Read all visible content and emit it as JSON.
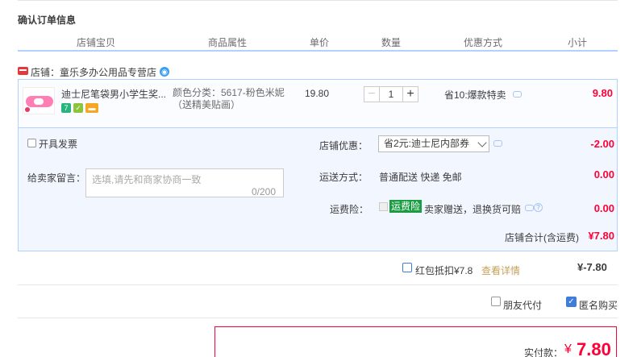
{
  "title": "确认订单信息",
  "headers": [
    "店铺宝贝",
    "商品属性",
    "单价",
    "数量",
    "优惠方式",
    "小计"
  ],
  "shop": {
    "label": "店铺：童乐多办公用品专营店"
  },
  "item": {
    "name": "迪士尼笔袋男小学生奖...",
    "props": "颜色分类：5617-粉色米妮（送精美贴画）",
    "price": "19.80",
    "quantity": "1",
    "minus": "−",
    "plus": "+",
    "promo": "省10:爆款特卖",
    "subtotal": "9.80",
    "badges": [
      "7",
      "✓",
      "▬"
    ]
  },
  "invoice": {
    "label": "开具发票"
  },
  "message": {
    "label": "给卖家留言：",
    "placeholder": "选填,请先和商家协商一致",
    "count": "0/200"
  },
  "shop_discount": {
    "label": "店铺优惠：",
    "selected": "省2元:迪士尼内部券",
    "value": "-2.00"
  },
  "shipping": {
    "label": "运送方式：",
    "text": "普通配送 快递 免邮",
    "value": "0.00"
  },
  "insurance": {
    "label": "运费险：",
    "tag": "运费险",
    "text": "卖家赠送，退换货可赔",
    "value": "0.00",
    "help": "?"
  },
  "shop_total": {
    "label": "店铺合计(含运费)",
    "value": "¥7.80"
  },
  "red_packet": {
    "label": "红包抵扣¥7.8",
    "link": "查看详情",
    "value": "¥-7.80"
  },
  "friend_pay": {
    "label": "朋友代付"
  },
  "anonymous": {
    "label": "匿名购买",
    "check": "✓"
  },
  "payment": {
    "label": "实付款：",
    "currency": "¥",
    "value": "7.80"
  }
}
